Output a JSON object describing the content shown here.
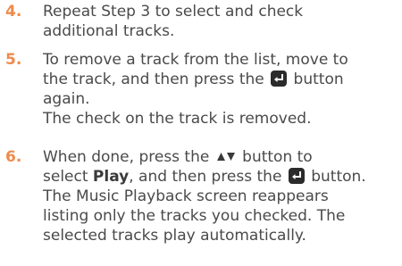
{
  "steps": [
    {
      "number": "4.",
      "lines": [
        "Repeat Step 3 to select and check",
        "additional tracks."
      ]
    },
    {
      "number": "5.",
      "line1": "To remove a track from the list, move to",
      "line2_before": "the track, and then press the",
      "line2_after": "button",
      "line3": "again.",
      "note": "The check on the track is removed."
    },
    {
      "number": "6.",
      "line1_before": "When done, press the",
      "line1_after": "button to",
      "line2_before": "select",
      "line2_bold": "Play",
      "line2_middle": ", and then press the",
      "line2_after": "button.",
      "line3": "The Music Playback screen reappears",
      "line4": "listing only the tracks you checked. The",
      "line5": "selected tracks play automatically."
    }
  ],
  "icons": {
    "enter_button": "enter-button-icon",
    "up_down": "up-down-arrow-icon"
  },
  "colors": {
    "step_number": "#f08a4b",
    "body_text": "#4a4a4a",
    "button_fill": "#2b2b2b"
  }
}
